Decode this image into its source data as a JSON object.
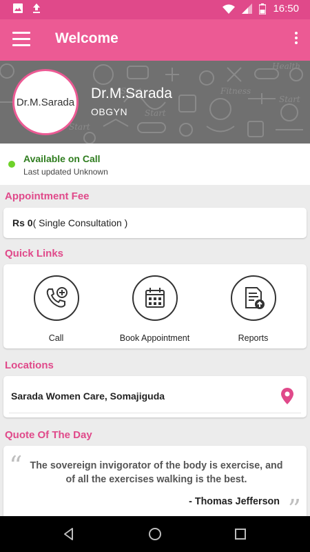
{
  "status_bar": {
    "time": "16:50"
  },
  "app_bar": {
    "title": "Welcome"
  },
  "profile": {
    "avatar_text": "Dr.M.Sarada",
    "name": "Dr.M.Sarada",
    "specialty": "OBGYN"
  },
  "availability": {
    "status": "Available on Call",
    "updated": "Last updated Unknown",
    "status_color": "#6ed22a"
  },
  "appointment_fee": {
    "title": "Appointment Fee",
    "amount": "Rs 0",
    "detail": "( Single Consultation )"
  },
  "quick_links": {
    "title": "Quick Links",
    "items": [
      {
        "label": "Call",
        "icon": "phone-plus-icon"
      },
      {
        "label": "Book Appointment",
        "icon": "calendar-icon"
      },
      {
        "label": "Reports",
        "icon": "report-upload-icon"
      }
    ]
  },
  "locations": {
    "title": "Locations",
    "items": [
      {
        "name": "Sarada Women Care, Somajiguda"
      }
    ]
  },
  "quote": {
    "title": "Quote Of The Day",
    "text": "The sovereign invigorator of the body is exercise, and of all the exercises walking is the best.",
    "author": "- Thomas Jefferson",
    "open_mark": "“",
    "close_mark": "”"
  },
  "theme": {
    "primary": "#ec5a94",
    "accent": "#e0498a"
  }
}
